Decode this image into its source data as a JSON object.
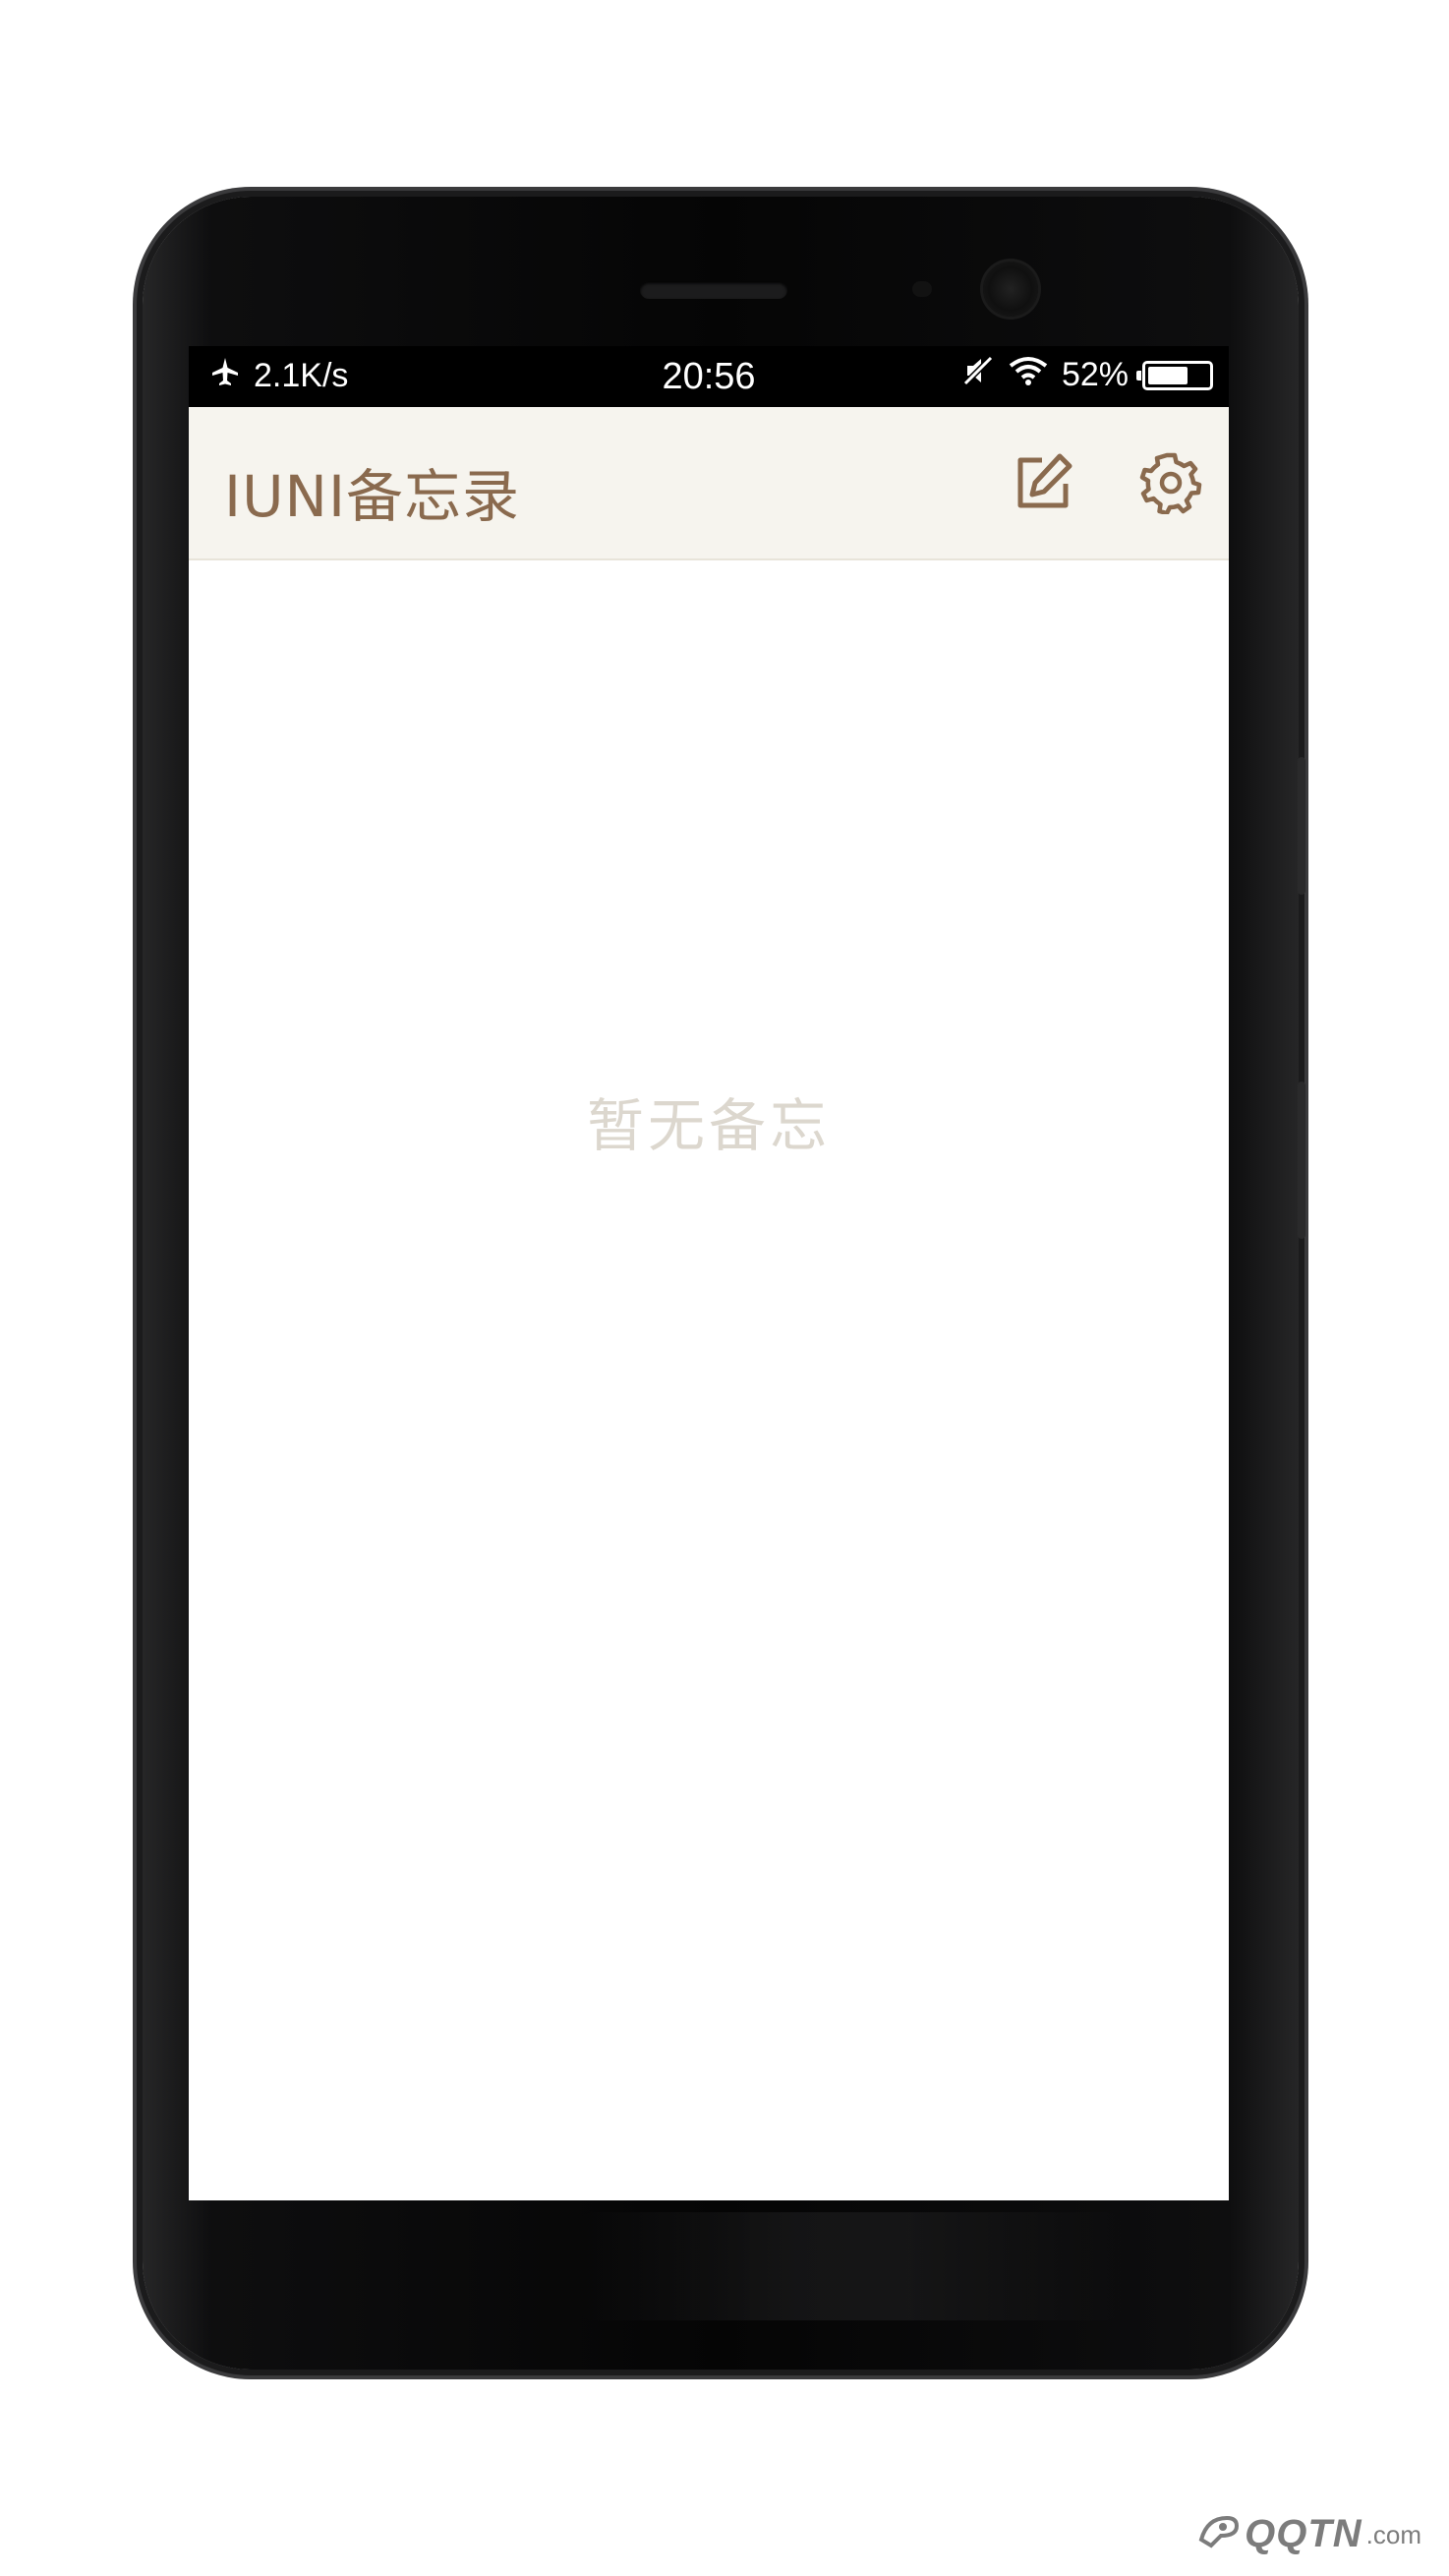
{
  "status_bar": {
    "network_speed": "2.1K/s",
    "time": "20:56",
    "battery_percent": "52%",
    "battery_level": 0.52,
    "icons": [
      "airplane-icon",
      "mute-icon",
      "wifi-icon",
      "battery-icon"
    ]
  },
  "app_bar": {
    "title": "IUNI备忘录",
    "actions": [
      {
        "name": "compose",
        "icon": "edit-icon"
      },
      {
        "name": "settings",
        "icon": "gear-icon"
      }
    ]
  },
  "main": {
    "empty_state": "暂无备忘"
  },
  "watermark": {
    "main": "QQTN",
    "suffix": ".com"
  },
  "colors": {
    "accent": "#8a6a4e",
    "appbar_bg": "#f6f4ee",
    "empty_text": "#dcd7ce"
  }
}
